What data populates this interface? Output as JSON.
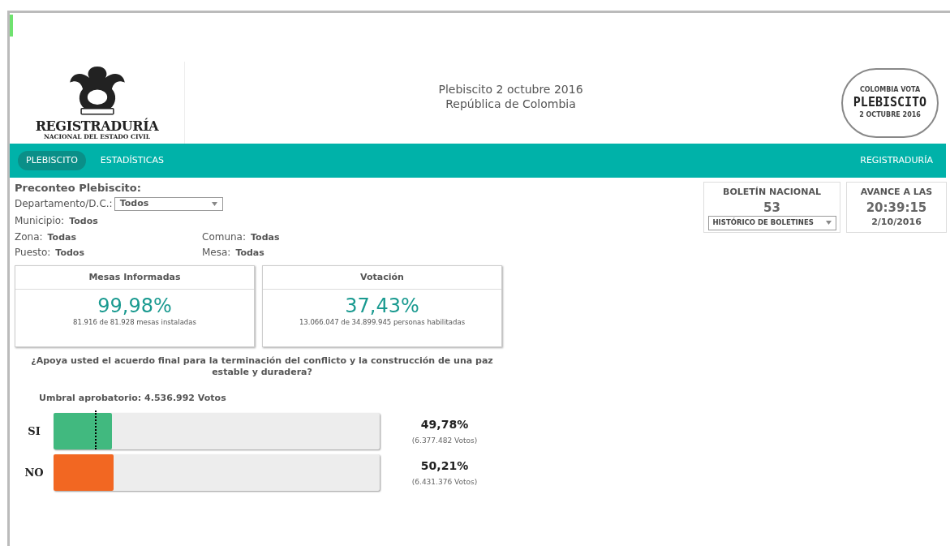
{
  "header": {
    "logo": {
      "name": "REGISTRADURÍA",
      "subtitle": "NACIONAL DEL ESTADO CIVIL"
    },
    "title": "Plebiscito 2 octubre 2016",
    "subtitle": "República de Colombia",
    "stamp": {
      "top": "COLOMBIA VOTA",
      "main": "PLEBISCITO",
      "bottom": "2 OCTUBRE 2016"
    }
  },
  "nav": {
    "items": [
      {
        "label": "PLEBISCITO",
        "selected": true
      },
      {
        "label": "ESTADÍSTICAS",
        "selected": false
      }
    ],
    "right": "REGISTRADURÍA"
  },
  "filters": {
    "title": "Preconteo Plebiscito:",
    "departamento": {
      "label": "Departamento/D.C.:",
      "value": "Todos"
    },
    "municipio": {
      "label": "Municipio:",
      "value": "Todos"
    },
    "zona": {
      "label": "Zona:",
      "value": "Todas"
    },
    "comuna": {
      "label": "Comuna:",
      "value": "Todas"
    },
    "puesto": {
      "label": "Puesto:",
      "value": "Todos"
    },
    "mesa": {
      "label": "Mesa:",
      "value": "Todas"
    }
  },
  "boletin": {
    "title": "BOLETÍN NACIONAL",
    "number": "53",
    "select": "HISTÓRICO DE BOLETINES"
  },
  "avance": {
    "title": "AVANCE A LAS",
    "time": "20:39:15",
    "date": "2/10/2016"
  },
  "stats": [
    {
      "title": "Mesas Informadas",
      "value": "99,98%",
      "detail": "81.916 de 81.928 mesas instaladas"
    },
    {
      "title": "Votación",
      "value": "37,43%",
      "detail": "13.066.047 de 34.899.945 personas habilitadas"
    }
  ],
  "question": "¿Apoya usted el acuerdo final para la terminación del conflicto y la construcción de una paz estable y duradera?",
  "threshold": "Umbral aprobatorio: 4.536.992 Votos",
  "options": [
    {
      "label": "SI",
      "level": 0.18,
      "color": "#41b97f",
      "percent": "49,78%",
      "votes": "(6.377.482 Votos)",
      "threshold_marker": true
    },
    {
      "label": "NO",
      "level": 0.185,
      "color": "#f26722",
      "percent": "50,21%",
      "votes": "(6.431.376 Votos)",
      "threshold_marker": false
    }
  ]
}
